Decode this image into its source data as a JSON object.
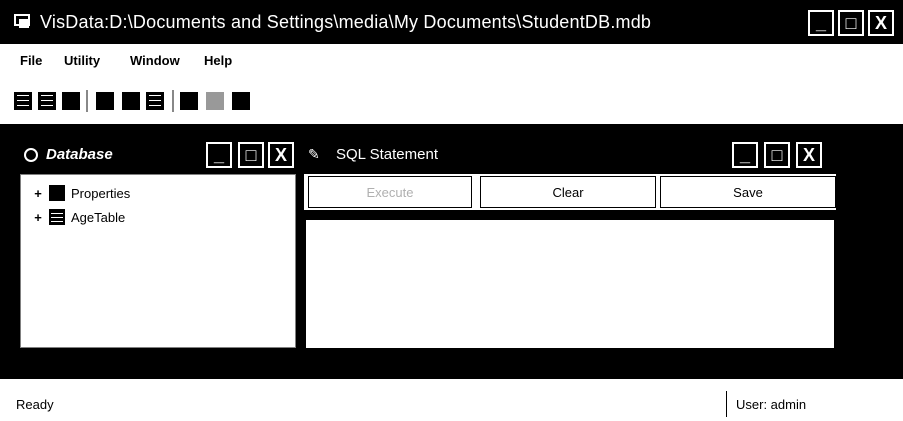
{
  "window": {
    "title": "VisData:D:\\Documents and Settings\\media\\My Documents\\StudentDB.mdb",
    "minimize": "_",
    "maximize": "□",
    "close": "X"
  },
  "menu": {
    "items": [
      "File",
      "Utility",
      "Window",
      "Help"
    ]
  },
  "database_window": {
    "title": "Database",
    "minimize": "_",
    "maximize": "□",
    "close": "X",
    "tree": [
      {
        "label": "Properties",
        "expander": "+",
        "icon": "properties-icon"
      },
      {
        "label": "AgeTable",
        "expander": "+",
        "icon": "table-icon"
      }
    ]
  },
  "sql_window": {
    "title": "SQL Statement",
    "minimize": "_",
    "maximize": "□",
    "close": "X",
    "execute_label": "Execute",
    "clear_label": "Clear",
    "save_label": "Save"
  },
  "status": {
    "text": "Ready",
    "user": "User: admin"
  }
}
